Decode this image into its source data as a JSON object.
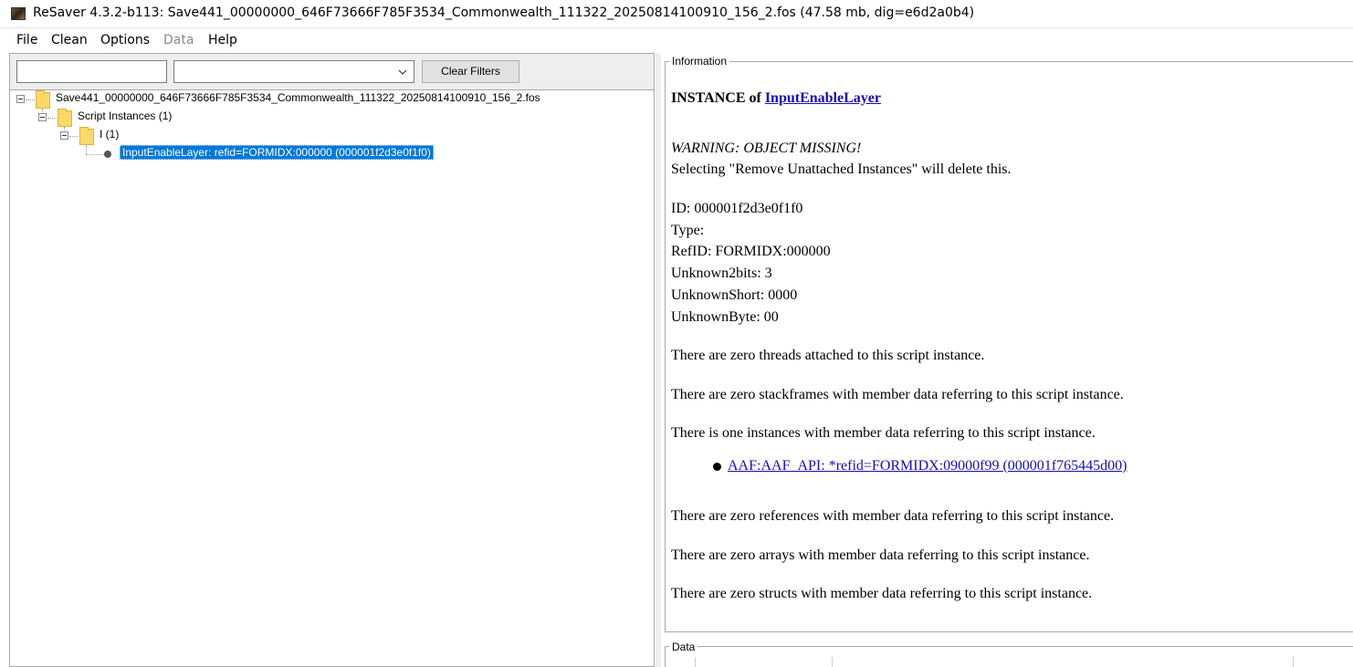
{
  "window": {
    "title": "ReSaver 4.3.2-b113: Save441_00000000_646F73666F785F3534_Commonwealth_111322_20250814100910_156_2.fos (47.58 mb, dig=e6d2a0b4)"
  },
  "menu": {
    "file": "File",
    "clean": "Clean",
    "options": "Options",
    "data": "Data",
    "help": "Help"
  },
  "filters": {
    "text_value": "",
    "select_value": "",
    "clear_label": "Clear Filters"
  },
  "tree": {
    "root_label": "Save441_00000000_646F73666F785F3534_Commonwealth_111322_20250814100910_156_2.fos",
    "group_label": "Script Instances (1)",
    "subgroup_label": "I (1)",
    "leaf_label": "InputEnableLayer: refid=FORMIDX:000000 (000001f2d3e0f1f0)"
  },
  "info": {
    "legend": "Information",
    "heading_prefix": "INSTANCE of",
    "heading_link": "InputEnableLayer",
    "warning": "WARNING: OBJECT MISSING!",
    "warning_detail": "Selecting \"Remove Unattached Instances\" will delete this.",
    "id": "ID: 000001f2d3e0f1f0",
    "type": "Type:",
    "refid": "RefID: FORMIDX:000000",
    "unknown2bits": "Unknown2bits: 3",
    "unknownshort": "UnknownShort: 0000",
    "unknownbyte": "UnknownByte: 00",
    "threads": "There are zero threads attached to this script instance.",
    "stackframes": "There are zero stackframes with member data referring to this script instance.",
    "instances": "There is one instances with member data referring to this script instance.",
    "instance_link": "AAF:AAF_API: *refid=FORMIDX:09000f99 (000001f765445d00)",
    "references": "There are zero references with member data referring to this script instance.",
    "arrays": "There are zero arrays with member data referring to this script instance.",
    "structs": "There are zero structs with member data referring to this script instance."
  },
  "data_panel": {
    "legend": "Data"
  },
  "colors": {
    "selection": "#0078d7",
    "link": "#1a0dab",
    "folder": "#ffd86a"
  }
}
